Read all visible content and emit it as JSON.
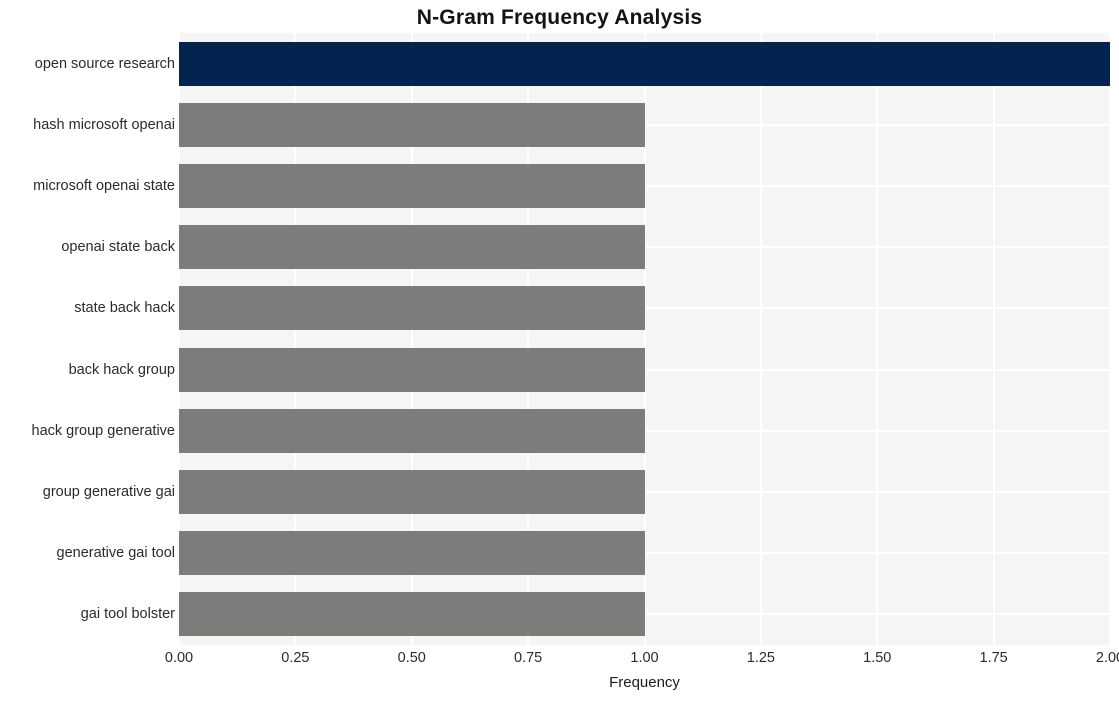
{
  "chart_data": {
    "type": "bar",
    "orientation": "horizontal",
    "title": "N-Gram Frequency Analysis",
    "xlabel": "Frequency",
    "ylabel": "",
    "categories": [
      "open source research",
      "hash microsoft openai",
      "microsoft openai state",
      "openai state back",
      "state back hack",
      "back hack group",
      "hack group generative",
      "group generative gai",
      "generative gai tool",
      "gai tool bolster"
    ],
    "values": [
      2,
      1,
      1,
      1,
      1,
      1,
      1,
      1,
      1,
      1
    ],
    "xlim": [
      0,
      2
    ],
    "xticks": [
      0,
      0.25,
      0.5,
      0.75,
      1,
      1.25,
      1.5,
      1.75,
      2
    ],
    "xtick_labels": [
      "0.00",
      "0.25",
      "0.50",
      "0.75",
      "1.00",
      "1.25",
      "1.50",
      "1.75",
      "2.00"
    ],
    "grid": true,
    "legend": null,
    "bar_colors": [
      "#042450",
      "#7c7c7a",
      "#7c7c7a",
      "#7c7c7a",
      "#7c7c7a",
      "#7c7c7a",
      "#7c7c7a",
      "#7c7c7a",
      "#7c7c7a",
      "#7c7c7a"
    ],
    "highlight_color": "#042450",
    "base_color": "#7c7c7a",
    "plot_background": "#f5f5f6",
    "figure_background": "#ffffff",
    "gridline_color": "#ffffff"
  }
}
